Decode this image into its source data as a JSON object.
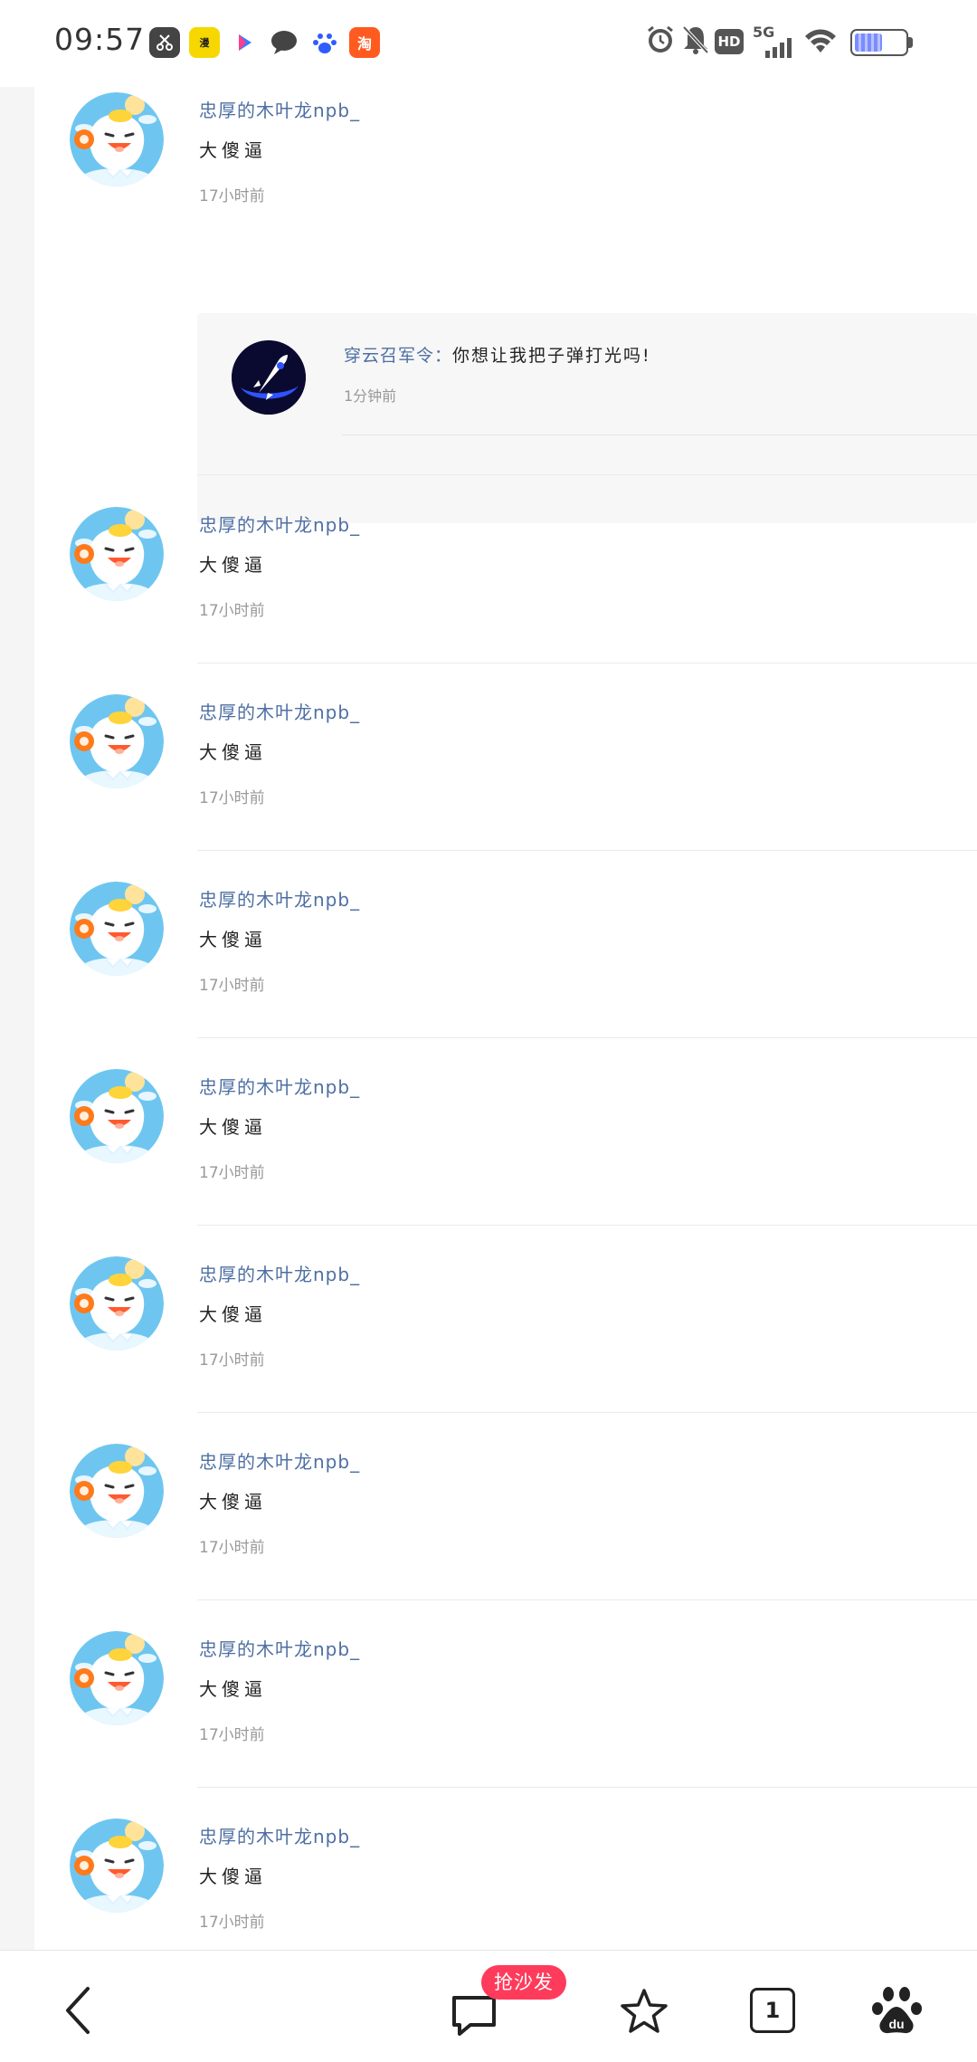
{
  "status_bar": {
    "time": "09:57",
    "apps": [
      "scissors-app-icon",
      "comic-app-icon",
      "youku-app-icon",
      "message-app-icon",
      "baidu-app-icon",
      "taobao-app-icon"
    ],
    "indicators": [
      "alarm-icon",
      "mute-icon",
      "hd-icon",
      "5g-signal-icon",
      "wifi-icon",
      "battery-icon"
    ],
    "network": "5G",
    "hd_label": "HD"
  },
  "comments": [
    {
      "name": "忠厚的木叶龙npb_",
      "text": "大傻逼",
      "time": "17小时前",
      "reply": {
        "name": "穿云召军令",
        "sep": "：",
        "text": "你想让我把子弹打光吗!",
        "time": "1分钟前"
      }
    },
    {
      "name": "忠厚的木叶龙npb_",
      "text": "大傻逼",
      "time": "17小时前"
    },
    {
      "name": "忠厚的木叶龙npb_",
      "text": "大傻逼",
      "time": "17小时前"
    },
    {
      "name": "忠厚的木叶龙npb_",
      "text": "大傻逼",
      "time": "17小时前"
    },
    {
      "name": "忠厚的木叶龙npb_",
      "text": "大傻逼",
      "time": "17小时前"
    },
    {
      "name": "忠厚的木叶龙npb_",
      "text": "大傻逼",
      "time": "17小时前"
    },
    {
      "name": "忠厚的木叶龙npb_",
      "text": "大傻逼",
      "time": "17小时前"
    },
    {
      "name": "忠厚的木叶龙npb_",
      "text": "大傻逼",
      "time": "17小时前"
    },
    {
      "name": "忠厚的木叶龙npb_",
      "text": "大傻逼",
      "time": "17小时前"
    }
  ],
  "bottom_bar": {
    "sofa_badge": "抢沙发",
    "tab_count": "1",
    "icons": [
      "back-icon",
      "comment-icon",
      "star-icon",
      "tabs-icon",
      "baidu-paw-icon"
    ],
    "badge_color": "#ff3b5c"
  },
  "colors": {
    "name_blue": "#4e6fa3",
    "text": "#222222",
    "muted": "#999999"
  }
}
